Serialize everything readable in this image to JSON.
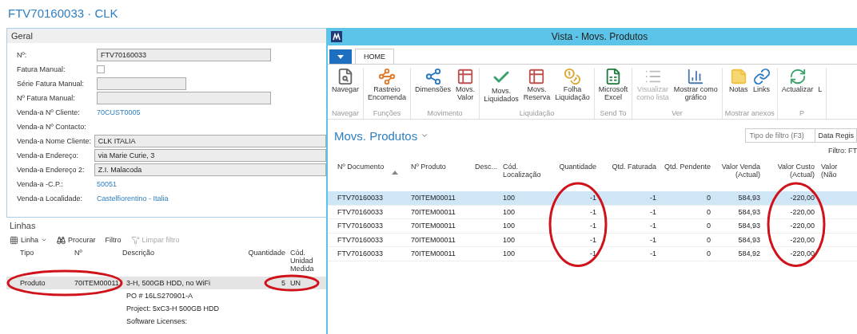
{
  "page_title": "FTV70160033 · CLK",
  "general": {
    "title": "Geral",
    "fields": [
      {
        "label": "Nº:",
        "kind": "input",
        "value": "FTV70160033"
      },
      {
        "label": "Fatura Manual:",
        "kind": "checkbox",
        "checked": false
      },
      {
        "label": "Série Fatura Manual:",
        "kind": "input-short"
      },
      {
        "label": "Nº Fatura Manual:",
        "kind": "input"
      },
      {
        "label": "Venda-a Nº Cliente:",
        "kind": "link",
        "value": "70CUST0005"
      },
      {
        "label": "Venda-a Nº Contacto:",
        "kind": "blank"
      },
      {
        "label": "Venda-a Nome Cliente:",
        "kind": "input-full",
        "value": "CLK ITALIA"
      },
      {
        "label": "Venda-a Endereço:",
        "kind": "input-full",
        "value": "via Marie Curie, 3"
      },
      {
        "label": "Venda-a Endereço 2:",
        "kind": "input-full",
        "value": "Z.I. Malacoda"
      },
      {
        "label": "Venda-a -C.P.:",
        "kind": "link",
        "value": "50051"
      },
      {
        "label": "Venda-a Localidade:",
        "kind": "link",
        "value": "Castelfiorentino - Italia"
      }
    ]
  },
  "lines": {
    "title": "Linhas",
    "toolbar": [
      {
        "label": "Linha",
        "kind": "grid-menu",
        "disabled": false
      },
      {
        "label": "Procurar",
        "kind": "binoculars",
        "disabled": false
      },
      {
        "label": "Filtro",
        "kind": "plain",
        "disabled": false
      },
      {
        "label": "Limpar filtro",
        "kind": "clear-filter",
        "disabled": true
      }
    ],
    "columns": [
      "Tipo",
      "Nº",
      "Descrição",
      "Quantidade",
      "Cód.\nUnidad\nMedida"
    ],
    "rows": [
      {
        "type": "Produto",
        "no": "70ITEM00011",
        "description": "3-H, 500GB HDD, no WiFi",
        "quantity": "5",
        "unit": "UN",
        "selected": true,
        "item_circled": true,
        "quantity_circled": true
      },
      {
        "description": "PO # 16LS270901-A",
        "selected": false,
        "item_circled": false,
        "quantity_circled": false
      },
      {
        "description": "Project: 5xC3-H 500GB HDD",
        "selected": false,
        "item_circled": false,
        "quantity_circled": false
      },
      {
        "description": "Software Licenses:",
        "selected": false,
        "item_circled": false,
        "quantity_circled": false
      }
    ]
  },
  "window": {
    "title": "Vista - Movs. Produtos",
    "tabs": [
      {
        "label": "HOME",
        "selected": true
      }
    ],
    "ribbon": [
      {
        "group": "Navegar",
        "buttons": [
          {
            "label": "Navegar",
            "kind": "navigate",
            "disabled": false
          }
        ]
      },
      {
        "group": "Funções",
        "buttons": [
          {
            "label": "Rastreio\nEncomenda",
            "kind": "tracking",
            "disabled": false
          }
        ]
      },
      {
        "group": "Movimento",
        "buttons": [
          {
            "label": "Dimensões",
            "kind": "dimensions",
            "disabled": false
          },
          {
            "label": "Movs.\nValor",
            "kind": "sheet",
            "disabled": false
          }
        ]
      },
      {
        "group": "Liquidação",
        "buttons": [
          {
            "label": "Movs.\nLiquidados",
            "kind": "check",
            "disabled": false
          },
          {
            "label": "Movs.\nReserva",
            "kind": "sheet",
            "disabled": false
          },
          {
            "label": "Folha\nLiquidação",
            "kind": "coins",
            "disabled": false
          }
        ]
      },
      {
        "group": "Send To",
        "buttons": [
          {
            "label": "Microsoft\nExcel",
            "kind": "excel",
            "disabled": false
          }
        ]
      },
      {
        "group": "Ver",
        "buttons": [
          {
            "label": "Visualizar\ncomo lista",
            "kind": "list",
            "disabled": true
          },
          {
            "label": "Mostrar como\ngráfico",
            "kind": "chart",
            "disabled": false
          }
        ]
      },
      {
        "group": "Mostrar anexos",
        "buttons": [
          {
            "label": "Notas",
            "kind": "note",
            "disabled": false
          },
          {
            "label": "Links",
            "kind": "link",
            "disabled": false
          }
        ]
      },
      {
        "group": "P",
        "buttons": [
          {
            "label": "Actualizar",
            "kind": "refresh",
            "disabled": false
          },
          {
            "label": "L",
            "kind": "plain",
            "disabled": false
          }
        ]
      }
    ],
    "list_title": "Movs. Produtos",
    "filter_placeholder": "Tipo de filtro (F3)",
    "filter_field": "Data Regis",
    "filter_label": "Filtro: FT",
    "columns": [
      {
        "label": "Nº Documento",
        "sorted": true,
        "circled": false
      },
      {
        "label": "Nº Produto",
        "sorted": false,
        "circled": false
      },
      {
        "label": "Desc...",
        "sorted": false,
        "circled": false
      },
      {
        "label": "Cód.\nLocalização",
        "sorted": false,
        "circled": false
      },
      {
        "label": "Quantidade",
        "sorted": false,
        "circled": true
      },
      {
        "label": "Qtd. Faturada",
        "sorted": false,
        "circled": false
      },
      {
        "label": "Qtd. Pendente",
        "sorted": false,
        "circled": false
      },
      {
        "label": "Valor Venda\n(Actual)",
        "sorted": false,
        "circled": false
      },
      {
        "label": "Valor Custo\n(Actual)",
        "sorted": false,
        "circled": true
      },
      {
        "label": "Valor\n(Não",
        "sorted": false,
        "circled": false
      }
    ],
    "rows": [
      {
        "doc": "FTV70160033",
        "product": "70ITEM00011",
        "location": "100",
        "quantity": "-1",
        "invoiced": "-1",
        "pending": "0",
        "sales": "584,93",
        "cost": "-220,00",
        "selected": true
      },
      {
        "doc": "FTV70160033",
        "product": "70ITEM00011",
        "location": "100",
        "quantity": "-1",
        "invoiced": "-1",
        "pending": "0",
        "sales": "584,93",
        "cost": "-220,00",
        "selected": false
      },
      {
        "doc": "FTV70160033",
        "product": "70ITEM00011",
        "location": "100",
        "quantity": "-1",
        "invoiced": "-1",
        "pending": "0",
        "sales": "584,93",
        "cost": "-220,00",
        "selected": false
      },
      {
        "doc": "FTV70160033",
        "product": "70ITEM00011",
        "location": "100",
        "quantity": "-1",
        "invoiced": "-1",
        "pending": "0",
        "sales": "584,93",
        "cost": "-220,00",
        "selected": false
      },
      {
        "doc": "FTV70160033",
        "product": "70ITEM00011",
        "location": "100",
        "quantity": "-1",
        "invoiced": "-1",
        "pending": "0",
        "sales": "584,92",
        "cost": "-220,00",
        "selected": false
      }
    ]
  }
}
